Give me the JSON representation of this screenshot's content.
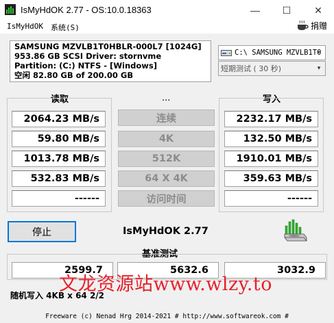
{
  "window": {
    "title": "IsMyHdOK 2.77 - OS:10.0.18363",
    "min_glyph": "—",
    "max_glyph": "☐",
    "close_glyph": "✕",
    "app_icon": "disk-bars-icon"
  },
  "menu": {
    "items": [
      "IsMyHdOK",
      "系统(S)"
    ],
    "donate_label": "捐赠",
    "donate_icon": "coffee-cup-icon"
  },
  "drive_info": {
    "lines": [
      "SAMSUNG MZVLB1T0HBLR-000L7 [1024G]",
      "953.86 GB  SCSI Driver: stornvme",
      "Partition: (C:) NTFS - [Windows]",
      "空闲 82.80 GB of 200.00 GB"
    ]
  },
  "selectors": {
    "drive": "C:\\ SAMSUNG MZVLB1T0",
    "test_mode": "短期测试 ( 30 秒)",
    "arrow": "▾"
  },
  "labels": {
    "read": "读取",
    "write": "写入",
    "middle": "...",
    "benchmark": "基准测试"
  },
  "read_values": [
    "2064.23 MB/s",
    "59.80 MB/s",
    "1013.78 MB/s",
    "532.83 MB/s",
    "------"
  ],
  "write_values": [
    "2232.17 MB/s",
    "132.50 MB/s",
    "1910.01 MB/s",
    "359.63 MB/s",
    "------"
  ],
  "test_buttons": [
    "连续",
    "4K",
    "512K",
    "64 X 4K",
    "访问时间"
  ],
  "controls": {
    "stop_label": "停止",
    "app_name": "IsMyHdOK 2.77"
  },
  "benchmark_values": [
    "2599.7",
    "5632.6",
    "3032.9"
  ],
  "watermark": "文龙资源站www.wlzy.to",
  "status_text": "随机写入 4KB x 64 2/2",
  "footer": "Freeware (c) Nenad Hrg 2014-2021 # http://www.softwareok.com   #",
  "colors": {
    "focus_border": "#0078d7",
    "watermark": "#e8202a",
    "disabled_text": "#8c8c8c"
  }
}
